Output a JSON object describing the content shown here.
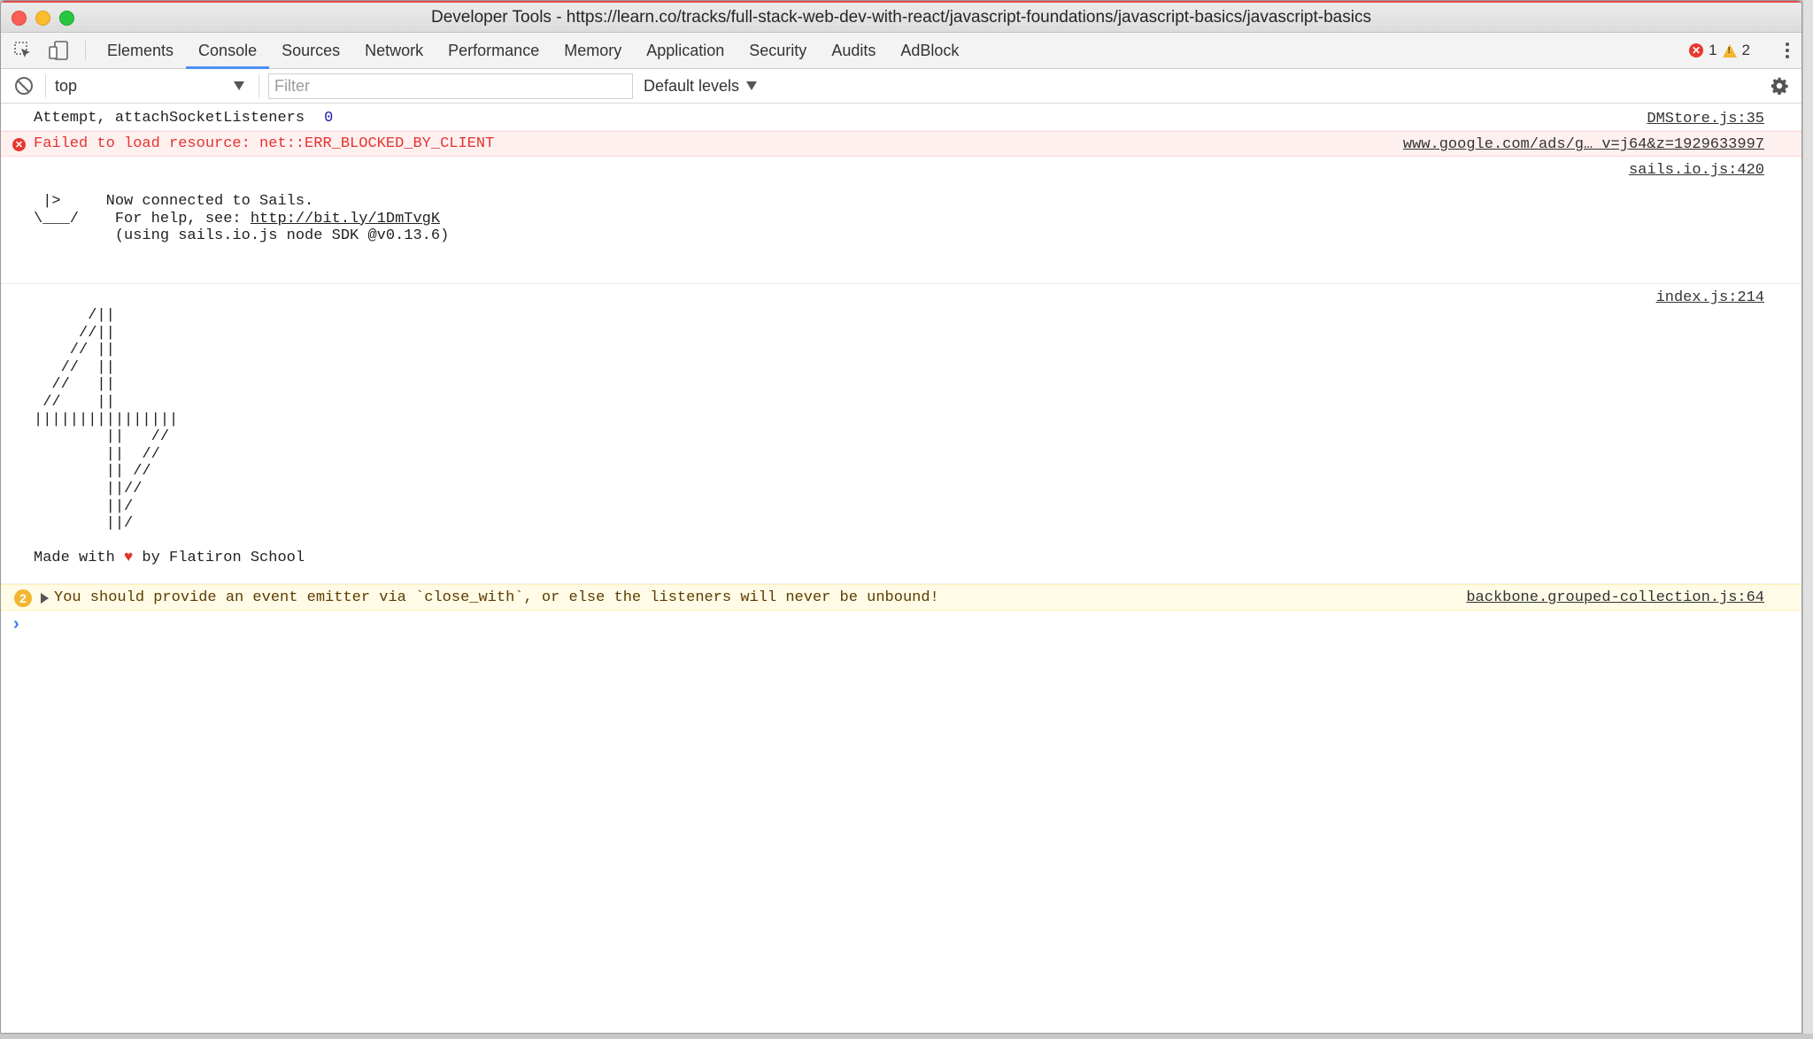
{
  "window": {
    "title": "Developer Tools - https://learn.co/tracks/full-stack-web-dev-with-react/javascript-foundations/javascript-basics/javascript-basics"
  },
  "tabs": [
    {
      "label": "Elements"
    },
    {
      "label": "Console",
      "active": true
    },
    {
      "label": "Sources"
    },
    {
      "label": "Network"
    },
    {
      "label": "Performance"
    },
    {
      "label": "Memory"
    },
    {
      "label": "Application"
    },
    {
      "label": "Security"
    },
    {
      "label": "Audits"
    },
    {
      "label": "AdBlock"
    }
  ],
  "counts": {
    "errors": "1",
    "warnings": "2"
  },
  "toolbar": {
    "context": "top",
    "filter_placeholder": "Filter",
    "levels": "Default levels"
  },
  "messages": {
    "log1": {
      "text": "Attempt, attachSocketListeners",
      "value": "0",
      "source": "DMStore.js:35"
    },
    "error1": {
      "text": "Failed to load resource: net::ERR_BLOCKED_BY_CLIENT",
      "source": "www.google.com/ads/g… v=j64&z=1929633997"
    },
    "sails": {
      "art_line1": " |>     Now connected to Sails.",
      "art_line2_prefix": "\\___/    For help, see: ",
      "link": "http://bit.ly/1DmTvgK",
      "art_line3": "         (using sails.io.js node SDK @v0.13.6)",
      "source": "sails.io.js:420"
    },
    "ascii": {
      "art": "      /||\n     //||\n    // ||\n   //  ||\n  //   ||\n //    ||\n||||||||||||||||\n        ||   //\n        ||  //\n        || //\n        ||//\n        ||/\n        ||/",
      "made_prefix": "Made with ",
      "heart": "♥",
      "made_suffix": " by Flatiron School",
      "source": "index.js:214"
    },
    "warn1": {
      "count": "2",
      "text": "You should provide an event emitter via `close_with`, or else the listeners will never be unbound!",
      "source": "backbone.grouped-collection.js:64"
    }
  },
  "colors": {
    "accent": "#4a8ff7",
    "error": "#e3342f",
    "warning": "#f2b632"
  }
}
